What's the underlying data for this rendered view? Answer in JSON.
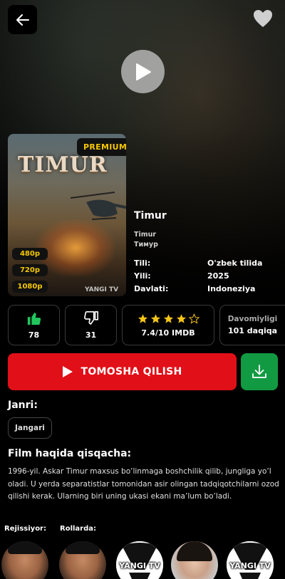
{
  "poster": {
    "badge": "PREMIUM",
    "art_title": "TIMUR",
    "qualities": [
      "480p",
      "720p",
      "1080p"
    ],
    "watermark": "YANGI TV"
  },
  "movie": {
    "title": "Timur",
    "alt_names": [
      "Timur",
      "Тимур"
    ],
    "details": [
      {
        "key": "Tili:",
        "value": "O'zbek tilida"
      },
      {
        "key": "Yili:",
        "value": "2025"
      },
      {
        "key": "Davlati:",
        "value": "Indoneziya"
      }
    ]
  },
  "stats": {
    "likes": "78",
    "dislikes": "31",
    "rating_text": "7.4/10 IMDB",
    "rating_stars": 3.5,
    "duration_label": "Davomiyligi",
    "duration_value": "101 daqiqa"
  },
  "actions": {
    "watch_label": "TOMOSHA QILISH"
  },
  "genre": {
    "title": "Janri:",
    "items": [
      "Jangari"
    ]
  },
  "description": {
    "title": "Film haqida qisqacha:",
    "text": "1996-yil. Askar Timur maxsus bo’linmaga boshchilik qilib, jungliga yo’l oladi. U yerda separatistlar tomonidan asir olingan tadqiqotchilarni ozod qilishi kerak. Ularning biri uning ukasi ekani ma’lum bo’ladi."
  },
  "cast": {
    "director_label": "Rejissiyor:",
    "actors_label": "Rollarda:",
    "logo_text": "YANGI TV"
  },
  "colors": {
    "accent_red": "#e10f18",
    "download_green": "#129a43",
    "premium_yellow": "#f5c600",
    "like_green": "#22c55e",
    "star_yellow": "#f5c518"
  }
}
